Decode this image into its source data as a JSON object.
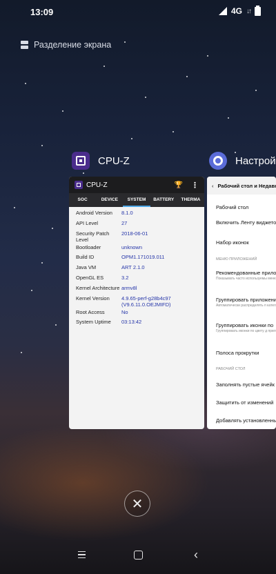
{
  "status": {
    "time": "13:09",
    "network": "4G"
  },
  "split_screen": {
    "label": "Разделение экрана"
  },
  "cards": {
    "cpuz": {
      "app_name": "CPU-Z",
      "window_title": "CPU-Z",
      "tabs": [
        "SOC",
        "DEVICE",
        "SYSTEM",
        "BATTERY",
        "THERMA"
      ],
      "active_tab": "SYSTEM",
      "rows": [
        {
          "k": "Android Version",
          "v": "8.1.0"
        },
        {
          "k": "API Level",
          "v": "27"
        },
        {
          "k": "Security Patch Level",
          "v": "2018-06-01"
        },
        {
          "k": "Bootloader",
          "v": "unknown"
        },
        {
          "k": "Build ID",
          "v": "OPM1.171019.011"
        },
        {
          "k": "Java VM",
          "v": "ART 2.1.0"
        },
        {
          "k": "OpenGL ES",
          "v": "3.2"
        },
        {
          "k": "Kernel Architecture",
          "v": "armv8l"
        },
        {
          "k": "Kernel Version",
          "v": "4.9.65-perf-g28b4c97\n(V9.6.11.0.OEJMIFD)"
        },
        {
          "k": "Root Access",
          "v": "No"
        },
        {
          "k": "System Uptime",
          "v": "03:13:42"
        }
      ]
    },
    "settings": {
      "app_name": "Настройк",
      "top_title": "Рабочий стол и Недавн",
      "items": [
        {
          "label": "Рабочий стол",
          "sub": ""
        },
        {
          "label": "Включить Ленту виджето",
          "sub": ""
        },
        {
          "label": "Набор иконок",
          "sub": ""
        },
        {
          "label": "МЕНЮ ПРИЛОЖЕНИЙ",
          "section": true
        },
        {
          "label": "Рекомендованные прило",
          "sub": "Показывать часто используемы меню"
        },
        {
          "label": "Группировать приложени",
          "sub": "Автоматически распределять п категориям"
        },
        {
          "label": "Группировать иконки по",
          "sub": "Группировать иконки по цвету д приложений"
        },
        {
          "label": "Полоса прокрутки",
          "sub": ""
        },
        {
          "label": "РАБОЧИЙ СТОЛ",
          "section": true
        },
        {
          "label": "Заполнять пустые ячейк",
          "sub": ""
        },
        {
          "label": "Защитить от изменений",
          "sub": ""
        },
        {
          "label": "Добавлять установленны на Рабочий стол автомат",
          "sub": ""
        }
      ]
    }
  },
  "controls": {
    "close_symbol": "✕"
  }
}
